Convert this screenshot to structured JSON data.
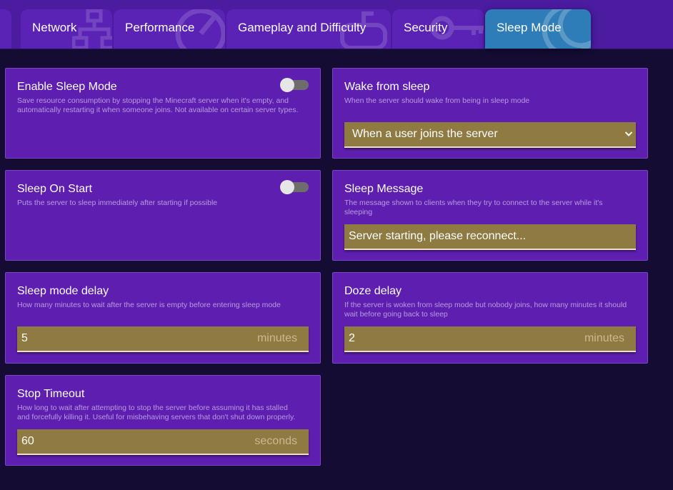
{
  "tabs": [
    {
      "label": "Network",
      "icon": "network-icon"
    },
    {
      "label": "Performance",
      "icon": "speedometer-icon"
    },
    {
      "label": "Gameplay and Difficulty",
      "icon": "controller-icon"
    },
    {
      "label": "Security",
      "icon": "key-icon"
    },
    {
      "label": "Sleep Mode",
      "icon": "moon-icon",
      "active": true
    }
  ],
  "settings": {
    "enable_sleep": {
      "title": "Enable Sleep Mode",
      "desc1": "Save resource consumption by stopping the Minecraft server when it's empty, and",
      "desc2": "automatically restarting it when someone joins. Not available on certain server types.",
      "enabled": false
    },
    "sleep_on_start": {
      "title": "Sleep On Start",
      "desc1": "Puts the server to sleep immediately after starting if possible",
      "enabled": false
    },
    "sleep_delay": {
      "title": "Sleep mode delay",
      "desc1": "How many minutes to wait after the server is empty before entering sleep mode",
      "value": "5",
      "unit": "minutes"
    },
    "stop_timeout": {
      "title": "Stop Timeout",
      "desc1": "How long to wait after attempting to stop the server before assuming it has stalled",
      "desc2": "and forcefully killing it. Useful for misbehaving servers that don't shut down properly.",
      "value": "60",
      "unit": "seconds"
    },
    "wake": {
      "title": "Wake from sleep",
      "desc1": "When the server should wake from being in sleep mode",
      "value": "When a user joins the server"
    },
    "sleep_message": {
      "title": "Sleep Message",
      "desc1": "The message shown to clients when they try to connect to the server while it's",
      "desc2": "sleeping",
      "value": "Server starting, please reconnect..."
    },
    "doze_delay": {
      "title": "Doze delay",
      "desc1": "If the server is woken from sleep mode but nobody joins, how many minutes it should",
      "desc2": "wait before going back to sleep",
      "value": "2",
      "unit": "minutes"
    }
  },
  "colors": {
    "background": "#140c33",
    "topbar": "#4b1ba0",
    "card": "#5e1fb0",
    "field": "#8f7a42",
    "active_tab": "#2e7db8"
  }
}
